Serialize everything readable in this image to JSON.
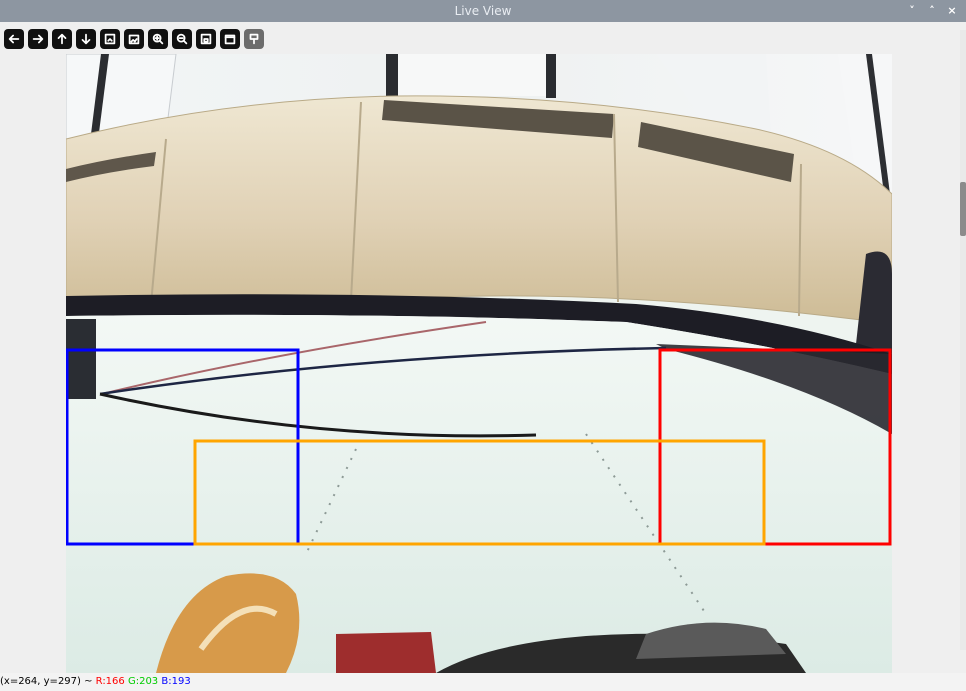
{
  "window": {
    "title": "Live View",
    "controls": [
      "˅",
      "˄",
      "×"
    ]
  },
  "toolbar": {
    "buttons": [
      {
        "name": "pan-left-icon",
        "disabled": false
      },
      {
        "name": "pan-right-icon",
        "disabled": false
      },
      {
        "name": "pan-up-icon",
        "disabled": false
      },
      {
        "name": "pan-down-icon",
        "disabled": false
      },
      {
        "name": "fit-window-icon",
        "disabled": false
      },
      {
        "name": "image-icon",
        "disabled": false
      },
      {
        "name": "zoom-in-icon",
        "disabled": false
      },
      {
        "name": "zoom-out-icon",
        "disabled": false
      },
      {
        "name": "save-icon",
        "disabled": false
      },
      {
        "name": "properties-icon",
        "disabled": false
      },
      {
        "name": "brush-icon",
        "disabled": true
      }
    ]
  },
  "status": {
    "coords": "(x=264, y=297) ~ ",
    "r": "R:166",
    "g": "G:203",
    "b": "B:193"
  },
  "overlays": {
    "left_box_color": "#0000ff",
    "right_box_color": "#ff0000",
    "center_box_color": "#ffa500"
  },
  "scene": {
    "wall_color": "#e8dcc0",
    "floor_color": "#e6f0ea",
    "ceiling_color": "#eef2f2"
  }
}
